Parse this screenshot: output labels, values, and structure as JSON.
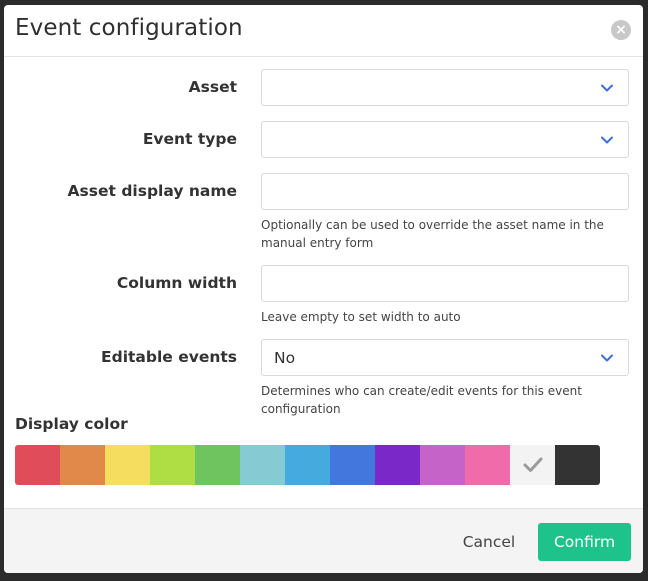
{
  "dialog": {
    "title": "Event configuration"
  },
  "form": {
    "asset": {
      "label": "Asset",
      "value": ""
    },
    "event_type": {
      "label": "Event type",
      "value": ""
    },
    "asset_display_name": {
      "label": "Asset display name",
      "value": "",
      "help": "Optionally can be used to override the asset name in the manual entry form"
    },
    "column_width": {
      "label": "Column width",
      "value": "",
      "help": "Leave empty to set width to auto"
    },
    "editable_events": {
      "label": "Editable events",
      "value": "No",
      "help": "Determines who can create/edit events for this event configuration"
    },
    "display_color": {
      "label": "Display color",
      "selected_index": 11,
      "colors": [
        "#e14c5b",
        "#e0894a",
        "#f5dd5f",
        "#afde44",
        "#6fc45f",
        "#86cbd3",
        "#45aade",
        "#4477de",
        "#7a29c8",
        "#c563c9",
        "#ef6baa",
        "#f3f3f3",
        "#333333"
      ]
    }
  },
  "footer": {
    "cancel_label": "Cancel",
    "confirm_label": "Confirm"
  },
  "colors": {
    "accent": "#1ec28b",
    "chevron": "#3f6fd1"
  }
}
